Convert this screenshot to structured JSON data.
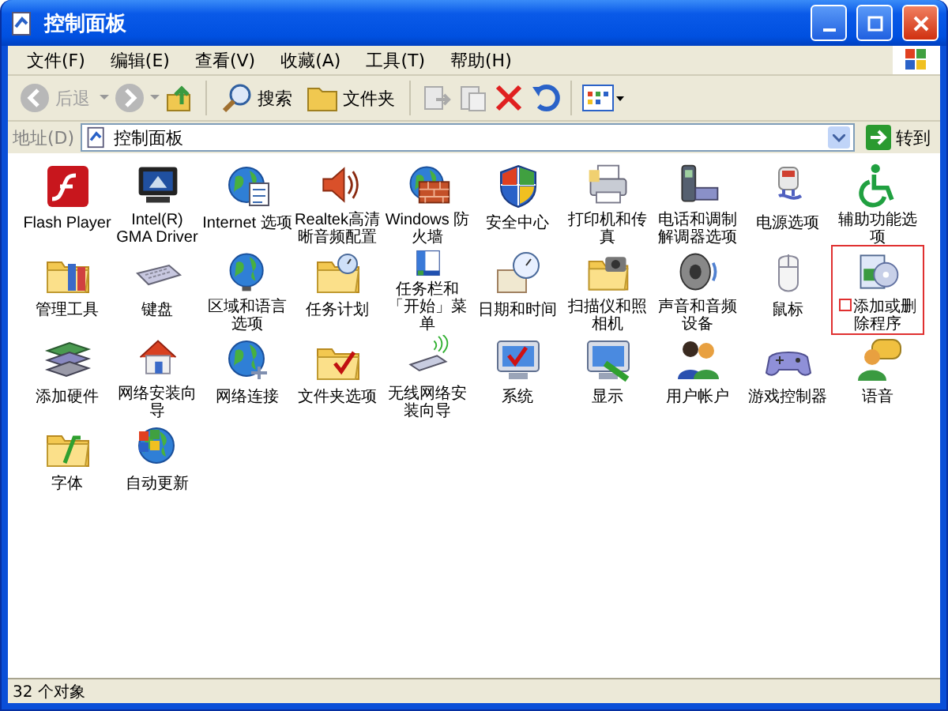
{
  "window": {
    "title": "控制面板"
  },
  "menu": [
    "文件(F)",
    "编辑(E)",
    "查看(V)",
    "收藏(A)",
    "工具(T)",
    "帮助(H)"
  ],
  "toolbar": {
    "back": {
      "label": "后退",
      "disabled": true
    },
    "search": "搜索",
    "folders": "文件夹"
  },
  "address": {
    "label": "地址(D)",
    "value": "控制面板",
    "go": "转到"
  },
  "items": [
    {
      "label": "Flash Player",
      "highlighted": false
    },
    {
      "label": "Intel(R) GMA Driver",
      "highlighted": false
    },
    {
      "label": "Internet 选项",
      "highlighted": false
    },
    {
      "label": "Realtek高清晰音频配置",
      "highlighted": false
    },
    {
      "label": "Windows 防火墙",
      "highlighted": false
    },
    {
      "label": "安全中心",
      "highlighted": false
    },
    {
      "label": "打印机和传真",
      "highlighted": false
    },
    {
      "label": "电话和调制解调器选项",
      "highlighted": false
    },
    {
      "label": "电源选项",
      "highlighted": false
    },
    {
      "label": "辅助功能选项",
      "highlighted": false
    },
    {
      "label": "管理工具",
      "highlighted": false
    },
    {
      "label": "键盘",
      "highlighted": false
    },
    {
      "label": "区域和语言选项",
      "highlighted": false
    },
    {
      "label": "任务计划",
      "highlighted": false
    },
    {
      "label": "任务栏和「开始」菜单",
      "highlighted": false
    },
    {
      "label": "日期和时间",
      "highlighted": false
    },
    {
      "label": "扫描仪和照相机",
      "highlighted": false
    },
    {
      "label": "声音和音频设备",
      "highlighted": false
    },
    {
      "label": "鼠标",
      "highlighted": false
    },
    {
      "label": "添加或删除程序",
      "highlighted": true
    },
    {
      "label": "添加硬件",
      "highlighted": false
    },
    {
      "label": "网络安装向导",
      "highlighted": false
    },
    {
      "label": "网络连接",
      "highlighted": false
    },
    {
      "label": "文件夹选项",
      "highlighted": false
    },
    {
      "label": "无线网络安装向导",
      "highlighted": false
    },
    {
      "label": "系统",
      "highlighted": false
    },
    {
      "label": "显示",
      "highlighted": false
    },
    {
      "label": "用户帐户",
      "highlighted": false
    },
    {
      "label": "游戏控制器",
      "highlighted": false
    },
    {
      "label": "语音",
      "highlighted": false
    },
    {
      "label": "字体",
      "highlighted": false
    },
    {
      "label": "自动更新",
      "highlighted": false
    }
  ],
  "status_bar": "32 个对象"
}
